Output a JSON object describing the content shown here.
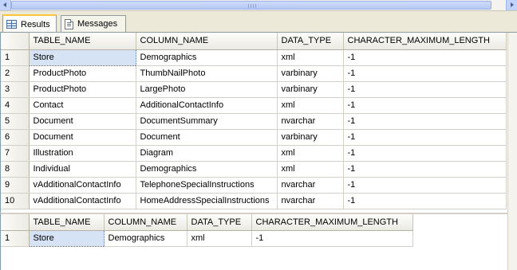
{
  "tabs": [
    {
      "label": "Results",
      "icon": "grid-icon",
      "active": true
    },
    {
      "label": "Messages",
      "icon": "messages-icon",
      "active": false
    }
  ],
  "grid1": {
    "columns": [
      "TABLE_NAME",
      "COLUMN_NAME",
      "DATA_TYPE",
      "CHARACTER_MAXIMUM_LENGTH"
    ],
    "rows": [
      [
        "1",
        "Store",
        "Demographics",
        "xml",
        "-1"
      ],
      [
        "2",
        "ProductPhoto",
        "ThumbNailPhoto",
        "varbinary",
        "-1"
      ],
      [
        "3",
        "ProductPhoto",
        "LargePhoto",
        "varbinary",
        "-1"
      ],
      [
        "4",
        "Contact",
        "AdditionalContactInfo",
        "xml",
        "-1"
      ],
      [
        "5",
        "Document",
        "DocumentSummary",
        "nvarchar",
        "-1"
      ],
      [
        "6",
        "Document",
        "Document",
        "varbinary",
        "-1"
      ],
      [
        "7",
        "Illustration",
        "Diagram",
        "xml",
        "-1"
      ],
      [
        "8",
        "Individual",
        "Demographics",
        "xml",
        "-1"
      ],
      [
        "9",
        "vAdditionalContactInfo",
        "TelephoneSpecialInstructions",
        "nvarchar",
        "-1"
      ],
      [
        "10",
        "vAdditionalContactInfo",
        "HomeAddressSpecialInstructions",
        "nvarchar",
        "-1"
      ]
    ]
  },
  "grid2": {
    "columns": [
      "TABLE_NAME",
      "COLUMN_NAME",
      "DATA_TYPE",
      "CHARACTER_MAXIMUM_LENGTH"
    ],
    "rows": [
      [
        "1",
        "Store",
        "Demographics",
        "xml",
        "-1"
      ]
    ]
  },
  "colors": {
    "selected_cell": "#d6e3f5",
    "active_tab_accent": "#ffc83c",
    "window_bg": "#ece9d8"
  }
}
